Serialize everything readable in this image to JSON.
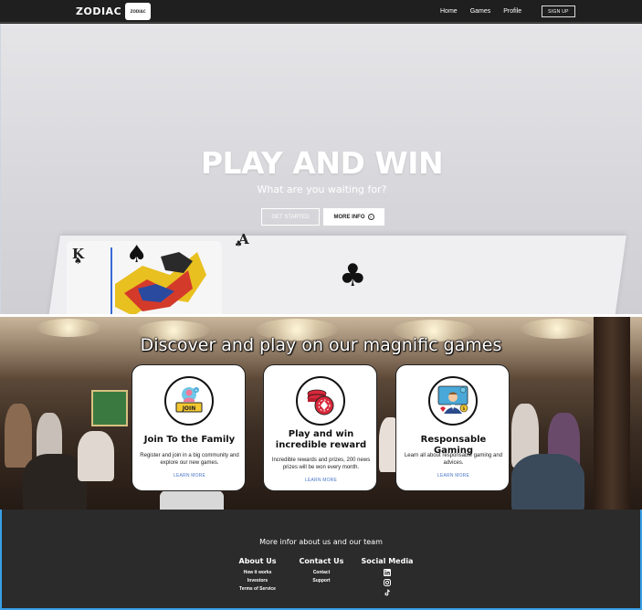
{
  "nav": {
    "brand": "ZODIAC",
    "logo_text": "ZODIAC",
    "links": [
      "Home",
      "Games",
      "Profile"
    ],
    "signup": "SIGN UP"
  },
  "hero": {
    "title": "PLAY AND WIN",
    "subtitle": "What are you waiting for?",
    "btn_started": "GET STARTED",
    "btn_info": "MORE INFO",
    "card_k": "K",
    "card_a": "A"
  },
  "games": {
    "title": "Discover and play on our magnific games",
    "features": [
      {
        "title": "Join To the Family",
        "text": "Register and join in a big community and explore our new games.",
        "link": "LEARN MORE",
        "icon": "join-icon",
        "badge": "JOIN"
      },
      {
        "title": "Play and win incredible reward",
        "text": "Incredible rewards and prizes, 200 news prizes will be won every month.",
        "link": "LEARN MORE",
        "icon": "casino-chips-icon"
      },
      {
        "title": "Responsable Gaming",
        "text": "Learn all about responsable gaming and advices.",
        "link": "LEARN MORE",
        "icon": "advisor-icon"
      }
    ]
  },
  "footer": {
    "title": "More infor about us and our team",
    "about": {
      "heading": "About Us",
      "links": [
        "How it works",
        "Investors",
        "Terms of Service"
      ]
    },
    "contact": {
      "heading": "Contact Us",
      "links": [
        "Contact",
        "Support"
      ]
    },
    "social": {
      "heading": "Social Media",
      "icons": [
        "linkedin-icon",
        "instagram-icon",
        "tiktok-icon"
      ]
    }
  },
  "colors": {
    "nav_bg": "#1f1f1f",
    "footer_bg": "#2b2b2b",
    "footer_border": "#3aa0e8",
    "learn_more": "#4a78c8"
  }
}
